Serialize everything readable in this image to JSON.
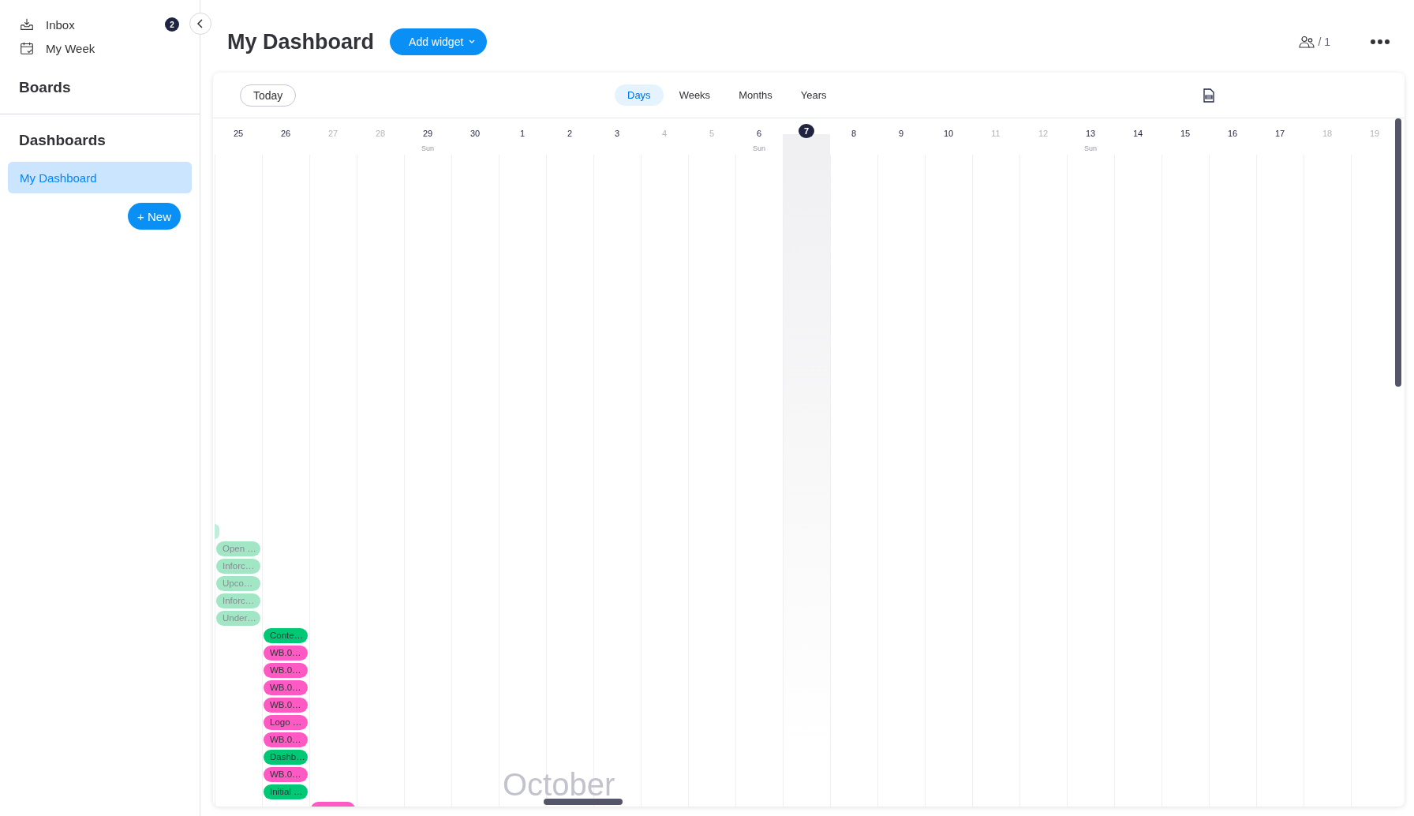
{
  "sidebar": {
    "nav": [
      {
        "label": "Inbox",
        "kind": "inbox",
        "badge": "2"
      },
      {
        "label": "My Week",
        "kind": "week"
      }
    ],
    "boards_heading": "Boards",
    "dashboards_heading": "Dashboards",
    "dashboards": [
      {
        "label": "My Dashboard",
        "selected": true
      }
    ],
    "new_button": "+ New"
  },
  "header": {
    "title": "My Dashboard",
    "add_widget": "Add widget",
    "members": "/ 1"
  },
  "widget": {
    "today_button": "Today",
    "tabs": [
      {
        "label": "Days",
        "selected": true
      },
      {
        "label": "Weeks",
        "selected": false
      },
      {
        "label": "Months",
        "selected": false
      },
      {
        "label": "Years",
        "selected": false
      }
    ],
    "month_label": "October",
    "days": [
      {
        "date": "25",
        "dim": false,
        "today": false,
        "events": [
          {
            "label": "Open …",
            "color": "#a3e6c6",
            "faded": true
          },
          {
            "label": "Inforc…",
            "color": "#a3e6c6",
            "faded": true
          },
          {
            "label": "Upco…",
            "color": "#a3e6c6",
            "faded": true
          },
          {
            "label": "Inforc…",
            "color": "#a3e6c6",
            "faded": true
          },
          {
            "label": "Under…",
            "color": "#a3e6c6",
            "faded": true
          }
        ]
      },
      {
        "date": "26",
        "dim": false,
        "today": false,
        "events": [
          {
            "label": "Conte…",
            "color": "#00c875",
            "faded": false
          },
          {
            "label": "WB.0…",
            "color": "#ff5ac4",
            "faded": false
          },
          {
            "label": "WB.0…",
            "color": "#ff5ac4",
            "faded": false
          },
          {
            "label": "WB.0…",
            "color": "#ff5ac4",
            "faded": false
          },
          {
            "label": "WB.0…",
            "color": "#ff5ac4",
            "faded": false
          },
          {
            "label": "Logo …",
            "color": "#ff5ac4",
            "faded": false
          },
          {
            "label": "WB.0…",
            "color": "#ff5ac4",
            "faded": false
          },
          {
            "label": "Dashb…",
            "color": "#00c875",
            "faded": false
          },
          {
            "label": "WB.0…",
            "color": "#ff5ac4",
            "faded": false
          },
          {
            "label": "Initial …",
            "color": "#00c875",
            "faded": false
          }
        ]
      },
      {
        "date": "27",
        "dim": true,
        "today": false
      },
      {
        "date": "28",
        "dim": true,
        "today": false
      },
      {
        "date": "29",
        "dim": false,
        "today": false,
        "sub": "Sun"
      },
      {
        "date": "30",
        "dim": false,
        "today": false
      },
      {
        "date": "1",
        "dim": false,
        "today": false
      },
      {
        "date": "2",
        "dim": false,
        "today": false
      },
      {
        "date": "3",
        "dim": false,
        "today": false
      },
      {
        "date": "4",
        "dim": true,
        "today": false
      },
      {
        "date": "5",
        "dim": true,
        "today": false
      },
      {
        "date": "6",
        "dim": false,
        "today": false,
        "sub": "Sun"
      },
      {
        "date": "7",
        "dim": false,
        "today": true
      },
      {
        "date": "8",
        "dim": false,
        "today": false
      },
      {
        "date": "9",
        "dim": false,
        "today": false
      },
      {
        "date": "10",
        "dim": false,
        "today": false
      },
      {
        "date": "11",
        "dim": true,
        "today": false
      },
      {
        "date": "12",
        "dim": true,
        "today": false
      },
      {
        "date": "13",
        "dim": false,
        "today": false,
        "sub": "Sun"
      },
      {
        "date": "14",
        "dim": false,
        "today": false
      },
      {
        "date": "15",
        "dim": false,
        "today": false
      },
      {
        "date": "16",
        "dim": false,
        "today": false
      },
      {
        "date": "17",
        "dim": false,
        "today": false
      },
      {
        "date": "18",
        "dim": true,
        "today": false
      },
      {
        "date": "19",
        "dim": true,
        "today": false
      }
    ]
  }
}
